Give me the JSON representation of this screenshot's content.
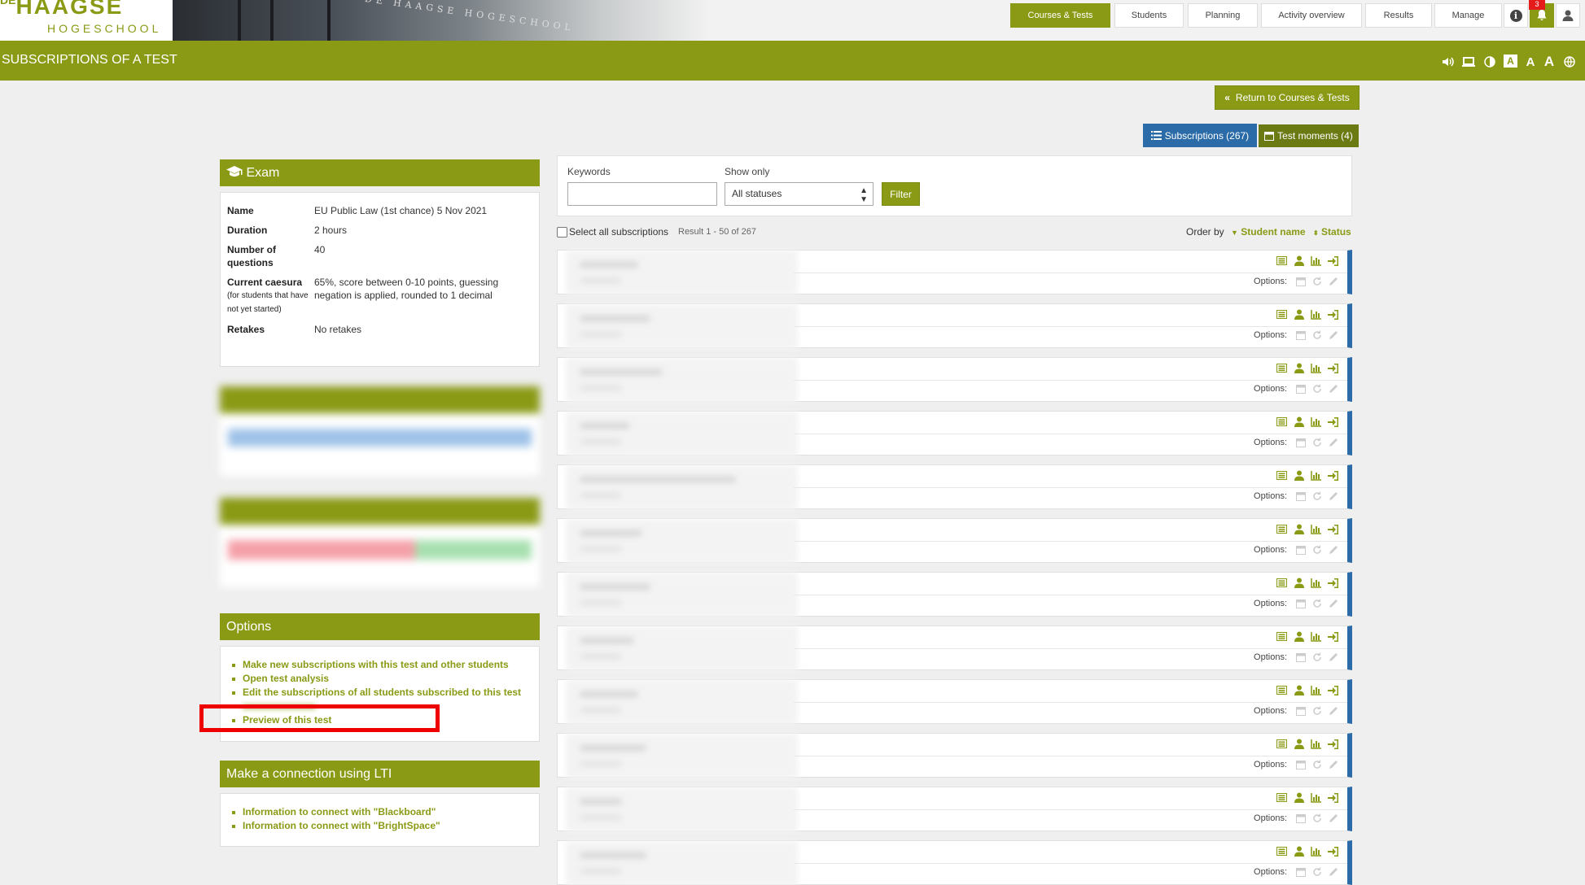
{
  "logo": {
    "line1_prefix": "DE",
    "line1_main": "HAAGSE",
    "line2": "HOGESCHOOL"
  },
  "banner": {
    "sign_text": "DE HAAGSE HOGESCHOOL"
  },
  "nav": [
    "Courses & Tests",
    "Students",
    "Planning",
    "Activity overview",
    "Results",
    "Manage"
  ],
  "header_icons": {
    "info": "info-icon",
    "bell": "bell-icon",
    "user": "user-icon",
    "notification_count": "3"
  },
  "page_title": "SUBSCRIPTIONS OF A TEST",
  "accessibility": {
    "boxed_letter": "A",
    "letter_medium": "A",
    "letter_large": "A"
  },
  "buttons": {
    "return": "Return to Courses & Tests",
    "subscriptions": "Subscriptions (267)",
    "test_moments": "Test moments (4)"
  },
  "exam": {
    "heading": "Exam",
    "rows": [
      {
        "key": "Name",
        "value": "EU Public Law (1st chance) 5 Nov 2021"
      },
      {
        "key": "Duration",
        "value": "2 hours"
      },
      {
        "key": "Number of questions",
        "value": "40"
      },
      {
        "key": "Current caesura",
        "key_note": "(for students that have not yet started)",
        "value": "65%, score between 0-10 points, guessing negation is applied, rounded to 1 decimal"
      },
      {
        "key": "Retakes",
        "value": "No retakes"
      }
    ]
  },
  "options": {
    "heading": "Options",
    "items": [
      "Make new subscriptions with this test and other students",
      "Open test analysis",
      "Edit the subscriptions of all students subscribed to this test",
      "Preview of this test"
    ]
  },
  "lti": {
    "heading": "Make a connection using LTI",
    "items": [
      "Information to connect with \"Blackboard\"",
      "Information to connect with \"BrightSpace\""
    ]
  },
  "filter": {
    "keywords_label": "Keywords",
    "keywords_value": "",
    "show_only_label": "Show only",
    "show_only_value": "All statuses",
    "button": "Filter"
  },
  "list": {
    "select_all": "Select all subscriptions",
    "result": "Result 1 - 50 of 267",
    "order_by": "Order by",
    "sort_name": "Student name",
    "sort_status": "Status",
    "options_label": "Options:",
    "row_count": 12
  },
  "colors": {
    "olive": "#8a9a15",
    "blue": "#2b6ca8",
    "red": "#e00000"
  }
}
